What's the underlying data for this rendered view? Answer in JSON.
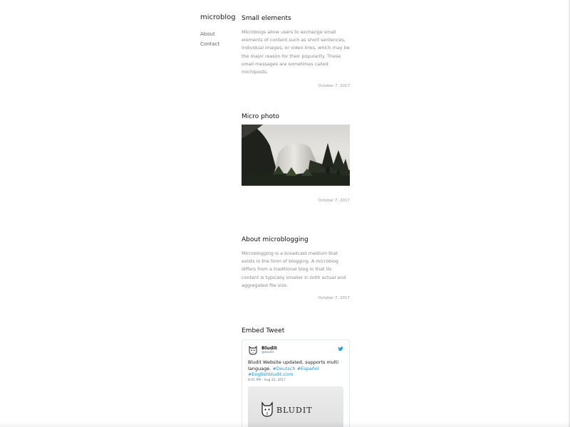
{
  "site": {
    "title": "microblog",
    "nav": [
      {
        "label": "About"
      },
      {
        "label": "Contact"
      }
    ]
  },
  "posts": [
    {
      "title": "Small elements",
      "body": "Microblogs allow users to exchange small elements of content such as short sentences, individual images, or video links, which may be the major reason for their popularity. These small messages are sometimes called microposts.",
      "date": "October 7, 2017"
    },
    {
      "title": "Micro photo",
      "date": "October 7, 2017"
    },
    {
      "title": "About microblogging",
      "body": "Microblogging is a broadcast medium that exists in the form of blogging. A microblog differs from a traditional blog in that its content is typically smaller in both actual and aggregated file size.",
      "date": "October 7, 2017"
    },
    {
      "title": "Embed Tweet"
    }
  ],
  "tweet": {
    "name": "Bludit",
    "handle": "@bludit",
    "text": "Bludit Website updated, supports multi language.",
    "tags": [
      "#Deutsch",
      "#Español",
      "#Englishbludit.com"
    ],
    "time": "8:01 PM - Aug 22, 2017",
    "card_brand": "BLUDIT"
  },
  "colors": {
    "link": "#1b95e0",
    "twitter": "#1da1f2"
  }
}
